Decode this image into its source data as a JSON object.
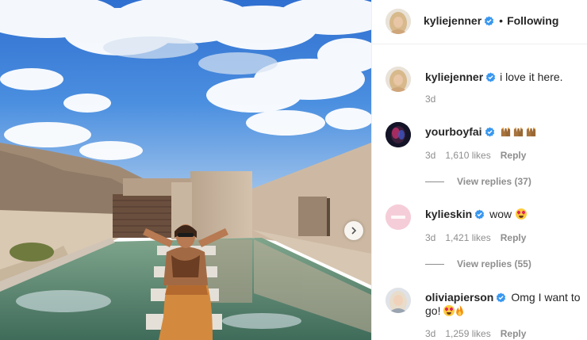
{
  "post": {
    "author": "kyliejenner",
    "separator": "•",
    "follow_status": "Following",
    "caption_author": "kyliejenner",
    "caption": "i love it here.",
    "caption_time": "3d"
  },
  "comments": [
    {
      "username": "yourboyfai",
      "text": "",
      "emojis": [
        "raising-hands",
        "raising-hands",
        "raising-hands"
      ],
      "time": "3d",
      "likes": "1,610 likes",
      "reply_label": "Reply",
      "view_replies": "View replies (37)"
    },
    {
      "username": "kylieskin",
      "text": "wow",
      "emojis": [
        "star-struck"
      ],
      "time": "3d",
      "likes": "1,421 likes",
      "reply_label": "Reply",
      "view_replies": "View replies (55)"
    },
    {
      "username": "oliviapierson",
      "text": "Omg I want to",
      "text_line2": "go!",
      "emojis": [
        "star-struck",
        "fire"
      ],
      "time": "3d",
      "likes": "1,259 likes",
      "reply_label": "Reply"
    }
  ],
  "icons": {
    "verified": "verified-badge-icon",
    "carousel_next": "chevron-right-icon"
  },
  "colors": {
    "verified_blue": "#3897f0",
    "meta_gray": "#8e8e8e",
    "text": "#262626"
  }
}
